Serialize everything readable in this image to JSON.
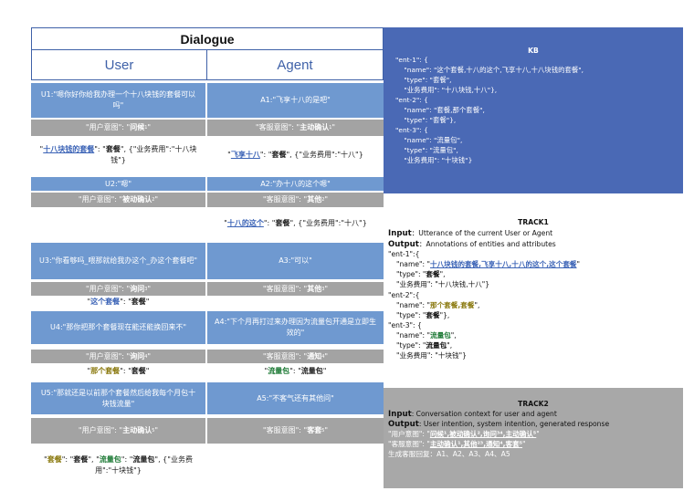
{
  "dialogue": {
    "title": "Dialogue",
    "user_header": "User",
    "agent_header": "Agent",
    "rows": {
      "u1": "U1:\"嗯你好你给我办理一个十八块钱的套餐可以吗\"",
      "a1": "A1:\"飞享十八的是吧\"",
      "ui1_pre": "\"用户意图\": \"",
      "ui1_val": "问候",
      "ui1_sup": "1",
      "ui1_post": "\"",
      "ai1_pre": "\"客服意图\": \"",
      "ai1_val": "主动确认",
      "ai1_sup": "1",
      "ai1_post": "\"",
      "ue1_ent": "十八块钱的套餐",
      "ue1_mid": "\": \"",
      "ue1_type": "套餐",
      "ue1_rest": "\", {\"业务费用\":\"十八块钱\"}",
      "ae1_ent": "飞享十八",
      "ae1_mid": "\": \"",
      "ae1_type": "套餐",
      "ae1_rest": "\", {\"业务费用\":\"十八\"}",
      "u2": "U2:\"嗯\"",
      "a2": "A2:\"办十八的这个嗯\"",
      "ui2_pre": "\"用户意图\": \"",
      "ui2_val": "被动确认",
      "ui2_sup": "2",
      "ui2_post": "\"",
      "ai2_pre": "\"客服意图\": \"",
      "ai2_val": "其他",
      "ai2_sup": "2",
      "ai2_post": "\"",
      "ae2_ent": "十八的这个",
      "ae2_mid": "\": \"",
      "ae2_type": "套餐",
      "ae2_rest": "\", {\"业务费用\":\"十八\"}",
      "u3": "U3:\"你看够吗_喂那就给我办这个_办这个套餐吧\"",
      "a3": "A3:\"可以\"",
      "ui3_pre": "\"用户意图\": \"",
      "ui3_val": "询问",
      "ui3_sup": "3",
      "ui3_post": "\"",
      "ai3_pre": "\"客服意图\": \"",
      "ai3_val": "其他",
      "ai3_sup": "3",
      "ai3_post": "\"",
      "ue3_ent": "这个套餐",
      "ue3_mid": "\": \"",
      "ue3_type": "套餐",
      "ue3_end": "\"",
      "u4": "U4:\"那你把那个套餐现在能还能换回来不\"",
      "a4": "A4:\"下个月再打过来办理因为流量包开通是立即生效的\"",
      "ui4_pre": "\"用户意图\": \"",
      "ui4_val": "询问",
      "ui4_sup": "4",
      "ui4_post": "\"",
      "ai4_pre": "\"客服意图\": \"",
      "ai4_val": "通知",
      "ai4_sup": "4",
      "ai4_post": "\"",
      "ue4_ent": "那个套餐",
      "ue4_mid": "\": \"",
      "ue4_type": "套餐",
      "ue4_end": "\"",
      "ae4_ent": "流量包",
      "ae4_mid": "\": \"",
      "ae4_type": "流量包",
      "ae4_end": "\"",
      "u5": "U5:\"那就还是以前那个套餐然后给我每个月包十块钱流量\"",
      "a5": "A5:\"不客气还有其他问\"",
      "ui5_pre": "\"用户意图\": \"",
      "ui5_val": "主动确认",
      "ui5_sup": "5",
      "ui5_post": "\"",
      "ai5_pre": "\"客服意图\": \"",
      "ai5_val": "客套",
      "ai5_sup": "5",
      "ai5_post": "\"",
      "ue5_ent1": "套餐",
      "ue5_mid1": "\": \"",
      "ue5_type1": "套餐",
      "ue5_sep": "\", \"",
      "ue5_ent2": "流量包",
      "ue5_mid2": "\": \"",
      "ue5_type2": "流量包",
      "ue5_rest": "\", {\"业务费用\":\"十块钱\"}"
    }
  },
  "kb": {
    "title": "KB",
    "lines": [
      "\"ent-1\": {",
      "    \"name\": \"这个套餐,十八的这个,飞享十八,十八块钱的套餐\",",
      "    \"type\": \"套餐\",",
      "    \"业务费用\": \"十八块钱,十八\"},",
      "\"ent-2\": {",
      "    \"name\": \"套餐,那个套餐\",",
      "    \"type\": \"套餐\"},",
      "\"ent-3\": {",
      "    \"name\": \"流量包\",",
      "    \"type\": \"流量包\",",
      "    \"业务费用\": \"十块钱\"}"
    ]
  },
  "track1": {
    "title": "TRACK1",
    "input_label": "Input",
    "input_text": "：Utterance of the current User or Agent",
    "output_label": "Output",
    "output_text": "：Annotations of entities and attributes",
    "e1_open": "\"ent-1\":{",
    "e1_name_pre": "\"name\": \"",
    "e1_name_val": "十八块钱的套餐,飞享十八,十八的这个,这个套餐",
    "e1_name_post": "\"",
    "e1_type_pre": "\"type\": \"",
    "e1_type_val": "套餐",
    "e1_type_post": "\",",
    "e1_fee": "\"业务费用\": \"十八块钱,十八\"}",
    "e2_open": "\"ent-2\":{",
    "e2_name_pre": "\"name\": \"",
    "e2_name_val": "那个套餐,套餐",
    "e2_name_post": "\",",
    "e2_type_pre": "\"type\": \"",
    "e2_type_val": "套餐",
    "e2_type_post": "\"},",
    "e3_open": "\"ent-3\": {",
    "e3_name_pre": "\"name\": \"",
    "e3_name_val": "流量包",
    "e3_name_post": "\",",
    "e3_type_pre": "\"type\": \"",
    "e3_type_val": "流量包",
    "e3_type_post": "\",",
    "e3_fee": "\"业务费用\": \"十块钱\"}"
  },
  "track2": {
    "title": "TRACK2",
    "input_label": "Input",
    "input_text": ": Conversation context for user and agent",
    "output_label": "Output",
    "output_text": ": User intention, system intention, generated response",
    "user_intent_pre": "\"用户意图\": \"",
    "user_intent_val": "问候¹,被动确认²,询问³⁴,主动确认⁵",
    "user_intent_post": "\"",
    "agent_intent_pre": "\"客服意图\": \"",
    "agent_intent_val": "主动确认¹,其他²³,通知⁴,客套⁵",
    "agent_intent_post": "\"",
    "response": "生成客服回复：A1、A2、A3、A4、A5"
  },
  "colors": {
    "kb_bg": "#4a69b5",
    "row_blue": "#6f99d0",
    "row_gray": "#a3a3a3",
    "entity_link": "#3b63b6",
    "entity_olive": "#8b7a10",
    "entity_green": "#1e7a36"
  }
}
